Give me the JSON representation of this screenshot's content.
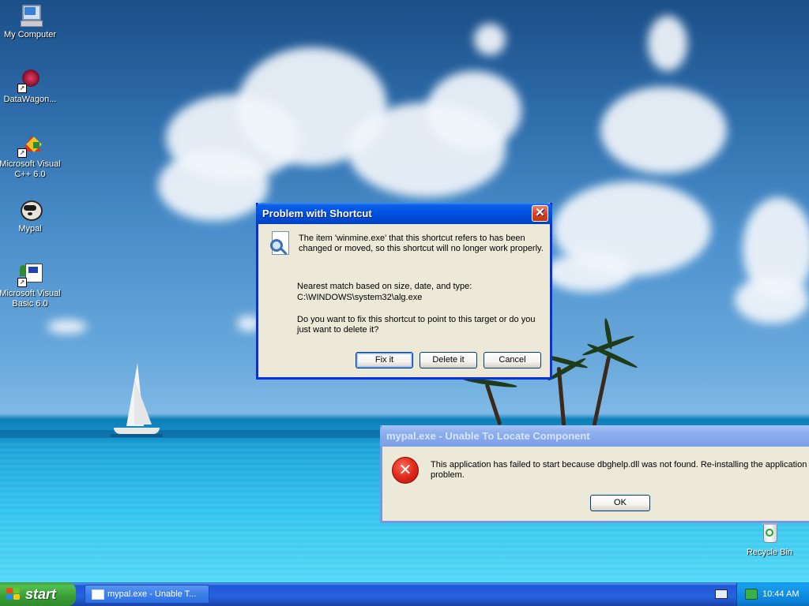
{
  "desktop": {
    "icons": [
      {
        "label": "My Computer",
        "icon": "my-computer-icon"
      },
      {
        "label": "DataWagon...",
        "icon": "datawagon-icon"
      },
      {
        "label": "Microsoft Visual C++ 6.0",
        "icon": "visual-cpp-icon"
      },
      {
        "label": "Mypal",
        "icon": "mypal-icon"
      },
      {
        "label": "Microsoft Visual Basic 6.0",
        "icon": "visual-basic-icon"
      },
      {
        "label": "Recycle Bin",
        "icon": "recycle-bin-icon"
      }
    ]
  },
  "shortcut_dialog": {
    "title": "Problem with Shortcut",
    "message_line1": "The item 'winmine.exe' that this shortcut refers to has been",
    "message_line2": "changed or moved, so this shortcut will no longer work properly.",
    "match_label": "Nearest match based on size, date, and type:",
    "match_path": "C:\\WINDOWS\\system32\\alg.exe",
    "question_line1": "Do you want to fix this shortcut to point to this target or do you",
    "question_line2": "just want to delete it?",
    "buttons": {
      "fix": "Fix it",
      "delete": "Delete it",
      "cancel": "Cancel"
    },
    "close_glyph": "✕"
  },
  "error_dialog": {
    "title": "mypal.exe - Unable To Locate Component",
    "message_line1": "This application has failed to start because dbghelp.dll was not found. Re-installing the application m",
    "message_line2": "problem.",
    "ok": "OK",
    "error_glyph": "✕"
  },
  "taskbar": {
    "start_label": "start",
    "task_button": "mypal.exe - Unable T...",
    "clock": "10:44 AM"
  },
  "colors": {
    "xp_blue": "#0054e3",
    "start_green": "#3a9d36",
    "error_red": "#d81e1e"
  }
}
